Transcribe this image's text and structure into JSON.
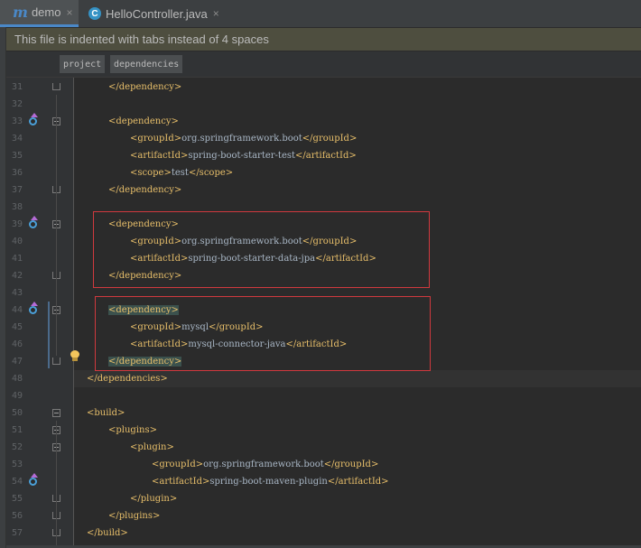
{
  "tabs": [
    {
      "icon": "maven-m-icon",
      "glyph": "m",
      "label": "demo",
      "close": "×",
      "active": true
    },
    {
      "icon": "class-c-icon",
      "glyph": "C",
      "label": "HelloController.java",
      "close": "×",
      "active": false
    }
  ],
  "banner": {
    "text": "This file is indented with tabs instead of 4 spaces"
  },
  "breadcrumbs": [
    "project",
    "dependencies"
  ],
  "code_lines": [
    {
      "n": "31",
      "parts": [
        {
          "t": "tag",
          "v": "</dependency>"
        }
      ]
    },
    {
      "n": "32",
      "parts": []
    },
    {
      "n": "33",
      "parts": [
        {
          "t": "tag",
          "v": "<dependency>"
        }
      ]
    },
    {
      "n": "34",
      "parts": [
        {
          "t": "tag",
          "v": "<groupId>"
        },
        {
          "t": "txt",
          "v": "org.springframework.boot"
        },
        {
          "t": "tag",
          "v": "</groupId>"
        }
      ]
    },
    {
      "n": "35",
      "parts": [
        {
          "t": "tag",
          "v": "<artifactId>"
        },
        {
          "t": "txt",
          "v": "spring-boot-starter-test"
        },
        {
          "t": "tag",
          "v": "</artifactId>"
        }
      ]
    },
    {
      "n": "36",
      "parts": [
        {
          "t": "tag",
          "v": "<scope>"
        },
        {
          "t": "txt",
          "v": "test"
        },
        {
          "t": "tag",
          "v": "</scope>"
        }
      ]
    },
    {
      "n": "37",
      "parts": [
        {
          "t": "tag",
          "v": "</dependency>"
        }
      ]
    },
    {
      "n": "38",
      "parts": []
    },
    {
      "n": "39",
      "parts": [
        {
          "t": "tag",
          "v": "<dependency>"
        }
      ]
    },
    {
      "n": "40",
      "parts": [
        {
          "t": "tag",
          "v": "<groupId>"
        },
        {
          "t": "txt",
          "v": "org.springframework.boot"
        },
        {
          "t": "tag",
          "v": "</groupId>"
        }
      ]
    },
    {
      "n": "41",
      "parts": [
        {
          "t": "tag",
          "v": "<artifactId>"
        },
        {
          "t": "txt",
          "v": "spring-boot-starter-data-jpa"
        },
        {
          "t": "tag",
          "v": "</artifactId>"
        }
      ]
    },
    {
      "n": "42",
      "parts": [
        {
          "t": "tag",
          "v": "</dependency>"
        }
      ]
    },
    {
      "n": "43",
      "parts": []
    },
    {
      "n": "44",
      "parts": [
        {
          "t": "tag",
          "v": "<dependency>",
          "hl": true
        }
      ]
    },
    {
      "n": "45",
      "parts": [
        {
          "t": "tag",
          "v": "<groupId>"
        },
        {
          "t": "txt",
          "v": "mysql"
        },
        {
          "t": "tag",
          "v": "</groupId>"
        }
      ]
    },
    {
      "n": "46",
      "parts": [
        {
          "t": "tag",
          "v": "<artifactId>"
        },
        {
          "t": "txt",
          "v": "mysql-connector-java"
        },
        {
          "t": "tag",
          "v": "</artifactId>"
        }
      ]
    },
    {
      "n": "47",
      "parts": [
        {
          "t": "tag",
          "v": "</dependency>",
          "hl": true
        }
      ]
    },
    {
      "n": "48",
      "parts": [
        {
          "t": "tag",
          "v": "</dependencies>"
        }
      ]
    },
    {
      "n": "49",
      "parts": []
    },
    {
      "n": "50",
      "parts": [
        {
          "t": "tag",
          "v": "<build>"
        }
      ]
    },
    {
      "n": "51",
      "parts": [
        {
          "t": "tag",
          "v": "<plugins>"
        }
      ]
    },
    {
      "n": "52",
      "parts": [
        {
          "t": "tag",
          "v": "<plugin>"
        }
      ]
    },
    {
      "n": "53",
      "parts": [
        {
          "t": "tag",
          "v": "<groupId>"
        },
        {
          "t": "txt",
          "v": "org.springframework.boot"
        },
        {
          "t": "tag",
          "v": "</groupId>"
        }
      ]
    },
    {
      "n": "54",
      "parts": [
        {
          "t": "tag",
          "v": "<artifactId>"
        },
        {
          "t": "txt",
          "v": "spring-boot-maven-plugin"
        },
        {
          "t": "tag",
          "v": "</artifactId>"
        }
      ]
    },
    {
      "n": "55",
      "parts": [
        {
          "t": "tag",
          "v": "</plugin>"
        }
      ]
    },
    {
      "n": "56",
      "parts": [
        {
          "t": "tag",
          "v": "</plugins>"
        }
      ]
    },
    {
      "n": "57",
      "parts": [
        {
          "t": "tag",
          "v": "</build>"
        }
      ]
    }
  ],
  "gutter_icons": {
    "run_markers": [
      "33",
      "39",
      "44",
      "54"
    ],
    "intention_bulb_line": "47"
  },
  "colors": {
    "tag": "#e8bf6a",
    "text": "#a9b7c6",
    "highlight_box": "#d0393e",
    "line_number": "#606366"
  }
}
